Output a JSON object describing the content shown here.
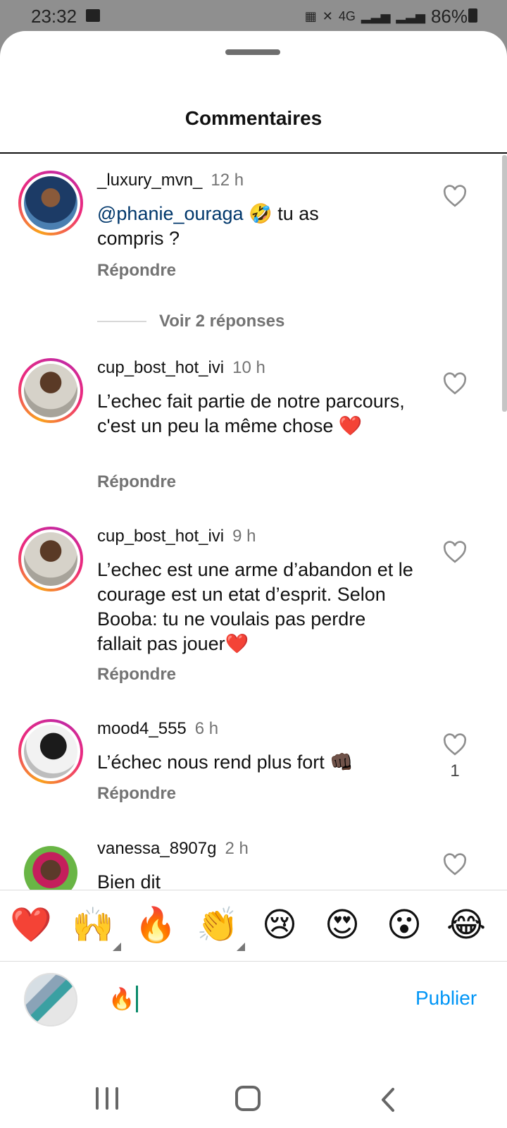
{
  "status_bar": {
    "time": "23:32",
    "network": "4G",
    "battery": "86%",
    "icons": [
      "photo-icon",
      "nfc-icon",
      "mute-icon",
      "signal-icon",
      "signal-icon",
      "battery-icon"
    ]
  },
  "sheet": {
    "title": "Commentaires"
  },
  "colors": {
    "mention": "#00376b",
    "publish": "#0095f6",
    "muted_text": "#737373"
  },
  "comments": [
    {
      "username": "_luxury_mvn_",
      "time": "12 h",
      "mention": "@phanie_ouraga",
      "text_line1_after_mention": " 🤣 tu as",
      "text_line2": "compris ?",
      "reply": "Répondre",
      "view_replies": "Voir 2 réponses"
    },
    {
      "username": "cup_bost_hot_ivi",
      "time": "10 h",
      "text": "L’echec fait partie de notre parcours, c'est un peu la même chose ❤️",
      "reply": "Répondre"
    },
    {
      "username": "cup_bost_hot_ivi",
      "time": "9 h",
      "text": "L’echec est une arme d’abandon et le courage est un etat d’esprit. Selon Booba: tu ne voulais pas perdre fallait pas jouer❤️",
      "reply": "Répondre"
    },
    {
      "username": "mood4_555",
      "time": "6 h",
      "text": "L’échec nous rend plus fort 👊🏿",
      "reply": "Répondre",
      "like_count": "1"
    },
    {
      "username": "vanessa_8907g",
      "time": "2 h",
      "text": "Bien dit"
    }
  ],
  "emoji_bar": [
    "❤️",
    "🙌",
    "🔥",
    "👏",
    "😢",
    "😍",
    "😮",
    "😂"
  ],
  "composer": {
    "value": "🔥",
    "publish_label": "Publier"
  }
}
